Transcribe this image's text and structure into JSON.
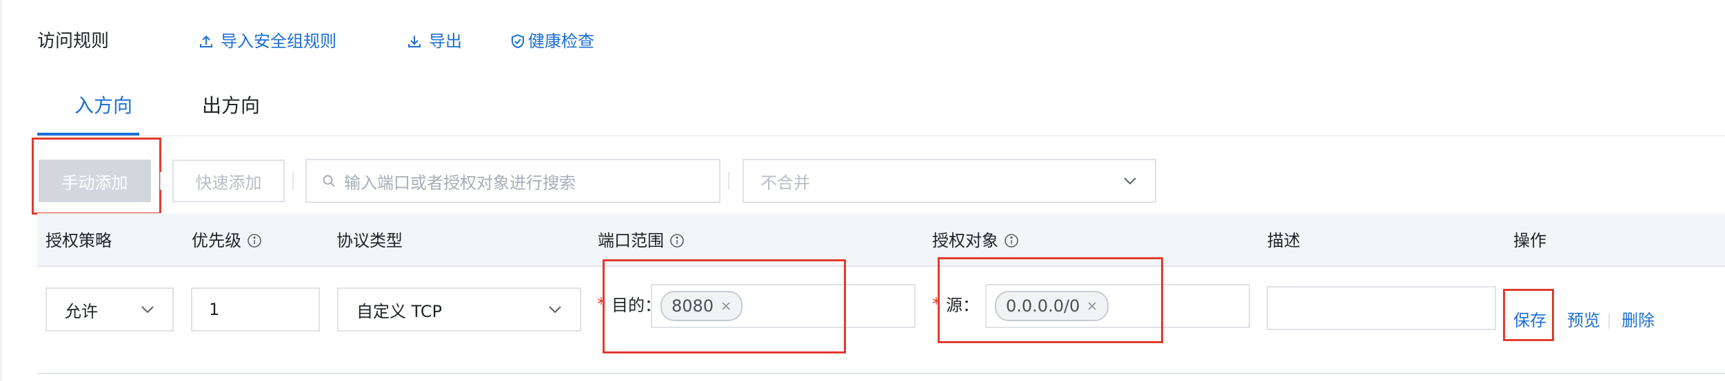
{
  "header": {
    "title": "访问规则",
    "actions": [
      {
        "label": "导入安全组规则",
        "icon": "import-icon"
      },
      {
        "label": "导出",
        "icon": "export-icon"
      },
      {
        "label": "健康检查",
        "icon": "shield-check-icon"
      }
    ]
  },
  "tabs": [
    {
      "label": "入方向",
      "active": true
    },
    {
      "label": "出方向",
      "active": false
    }
  ],
  "toolbar": {
    "manual_add": "手动添加",
    "quick_add": "快速添加",
    "search_placeholder": "输入端口或者授权对象进行搜索",
    "merge_select": "不合并"
  },
  "table": {
    "columns": [
      "授权策略",
      "优先级",
      "协议类型",
      "端口范围",
      "授权对象",
      "描述",
      "操作"
    ]
  },
  "row": {
    "policy": "允许",
    "priority": "1",
    "protocol": "自定义 TCP",
    "port_required": "*",
    "port_label": "目的：",
    "port_tag": "8080",
    "source_required": "*",
    "source_label": "源：",
    "source_tag": "0.0.0.0/0",
    "description": "",
    "actions": {
      "save": "保存",
      "preview": "预览",
      "delete": "删除"
    }
  },
  "colors": {
    "accent": "#1a6fd6",
    "highlight": "#e23a2e",
    "disabled": "#d3d7dd"
  }
}
